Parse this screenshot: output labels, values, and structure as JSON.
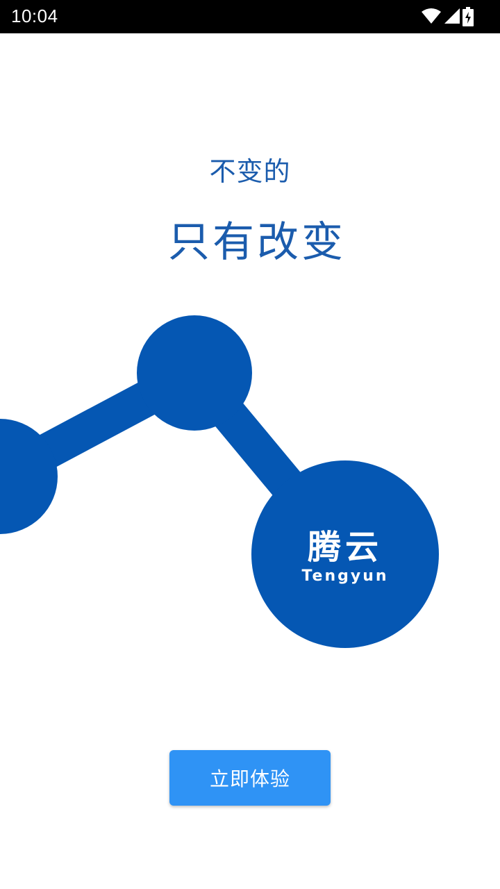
{
  "status_bar": {
    "time": "10:04",
    "icons": [
      "wifi-icon",
      "signal-icon",
      "battery-charging-icon"
    ]
  },
  "headline": {
    "subtitle": "不变的",
    "title": "只有改变"
  },
  "logo": {
    "chinese": "腾云",
    "english": "Tengyun"
  },
  "start_button": {
    "label": "立即体验"
  },
  "colors": {
    "brand_blue": "#0557b3",
    "headline_blue": "#1b5cad",
    "button_blue": "#2f93f5",
    "status_bar": "#000000"
  }
}
